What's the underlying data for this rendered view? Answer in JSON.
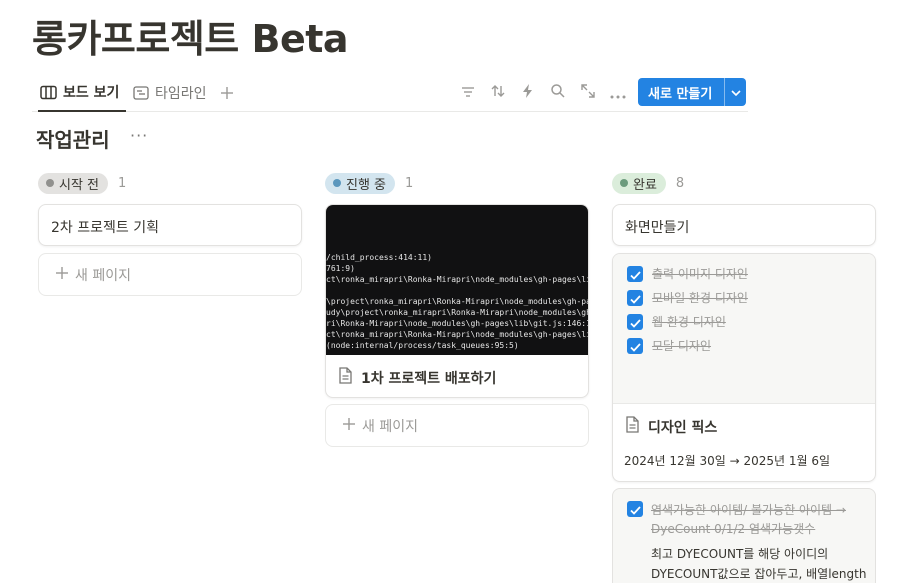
{
  "page": {
    "title": "롱카프로젝트 Beta"
  },
  "views": {
    "tabs": [
      {
        "label": "보드 보기",
        "active": true,
        "icon": "board-icon"
      },
      {
        "label": "타임라인",
        "active": false,
        "icon": "timeline-icon"
      }
    ],
    "add_icon": "plus-icon",
    "tools": [
      "filter-icon",
      "sort-icon",
      "automation-icon",
      "search-icon",
      "expand-icon",
      "more-icon"
    ],
    "new_button": {
      "label": "새로 만들기",
      "arrow_icon": "chevron-down-icon",
      "color": "#2383e2"
    }
  },
  "database": {
    "title": "작업관리",
    "more": "···"
  },
  "columns": [
    {
      "status": "시작 전",
      "count": "1",
      "pill_bg": "#e3e2e0",
      "dot": "#91918e",
      "cards": [
        {
          "title": "2차 프로젝트 기획"
        }
      ],
      "new_page": "새 페이지"
    },
    {
      "status": "진행 중",
      "count": "1",
      "pill_bg": "#d3e5ef",
      "dot": "#5b97bd",
      "cards": [
        {
          "title": "1차 프로젝트 배포하기",
          "cover_lines": [
            "/child_process:414:11)",
            "761:9)",
            "ct\\ronka_mirapri\\Ronka-Mirapri\\node_modules\\gh-pages\\lib\\git",
            "",
            "\\project\\ronka_mirapri\\Ronka-Mirapri\\node_modules\\gh-pages\\",
            "udy\\project\\ronka_mirapri\\Ronka-Mirapri\\node_modules\\gh-pa",
            "ri\\Ronka-Mirapri\\node_modules\\gh-pages\\lib\\git.js:146:15)",
            "ct\\ronka_mirapri\\Ronka-Mirapri\\node_modules\\gh-pages\\lib\\inde",
            " (node:internal/process/task_queues:95:5)"
          ]
        }
      ],
      "new_page": "새 페이지"
    },
    {
      "status": "완료",
      "count": "8",
      "pill_bg": "#dbeddb",
      "dot": "#6c9b7d",
      "cards": [
        {
          "title": "화면만들기"
        },
        {
          "title": "디자인 픽스",
          "checklist": [
            "출력 이미지 디자인",
            "모바일 환경 디자인",
            "웹 환경 디자인",
            "모달 디자인"
          ],
          "date": "2024년 12월 30일 → 2025년 1월 6일"
        },
        {
          "checked_text": "염색가능한 아이템/ 불가능한 아이템 → DyeCount 0/1/2 염색가능갯수",
          "description": "최고  DYECOUNT를 해당 아이디의 DYECOUNT값으로 잡아두고, 배열length"
        }
      ]
    }
  ]
}
